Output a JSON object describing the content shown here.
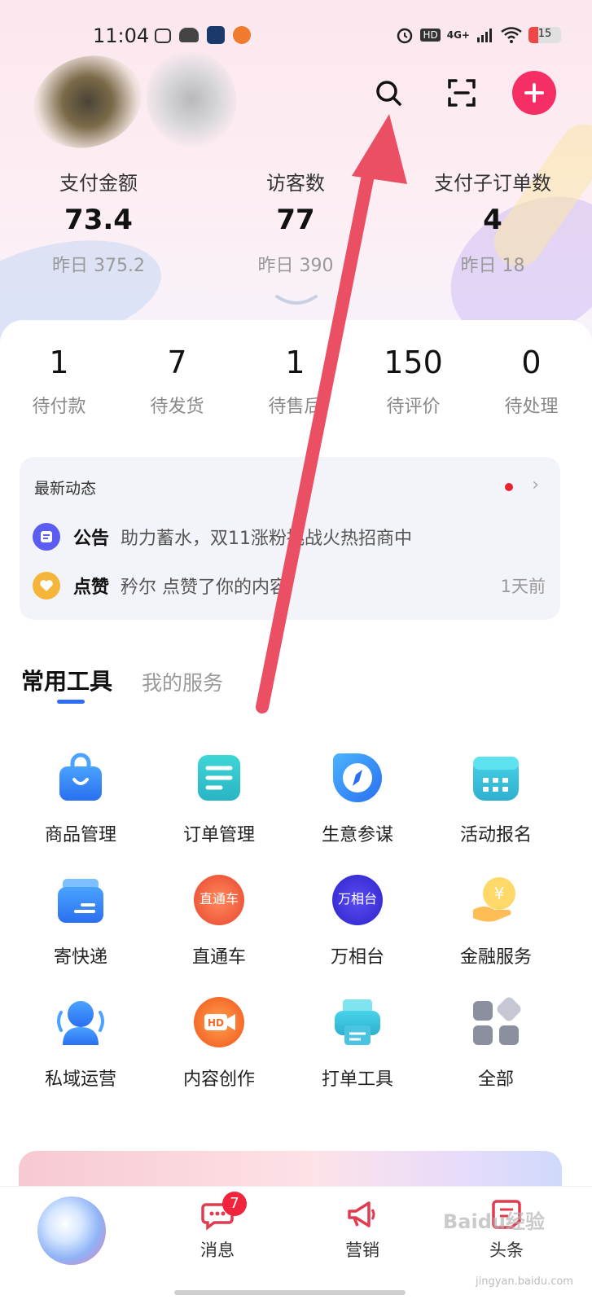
{
  "status_bar": {
    "time": "11:04",
    "network_label": "4G+",
    "hd_label": "HD",
    "battery": "15"
  },
  "header": {
    "search_icon": "search-icon",
    "scan_icon": "scan-icon",
    "add_icon": "plus-icon"
  },
  "stats": [
    {
      "label": "支付金额",
      "value": "73.4",
      "yesterday": "昨日 375.2"
    },
    {
      "label": "访客数",
      "value": "77",
      "yesterday": "昨日 390"
    },
    {
      "label": "支付子订单数",
      "value": "4",
      "yesterday": "昨日 18"
    }
  ],
  "orders": [
    {
      "count": "1",
      "label": "待付款"
    },
    {
      "count": "7",
      "label": "待发货"
    },
    {
      "count": "1",
      "label": "待售后"
    },
    {
      "count": "150",
      "label": "待评价"
    },
    {
      "count": "0",
      "label": "待处理"
    }
  ],
  "news": {
    "title": "最新动态",
    "items": [
      {
        "tag": "公告",
        "text": "助力蓄水，双11涨粉挑战火热招商中",
        "time": ""
      },
      {
        "tag": "点赞",
        "text": "矜尔 点赞了你的内容",
        "time": "1天前"
      }
    ]
  },
  "tabs": {
    "active": "常用工具",
    "inactive": "我的服务"
  },
  "tools": [
    {
      "label": "商品管理",
      "icon": "shopping-bag-icon"
    },
    {
      "label": "订单管理",
      "icon": "order-list-icon"
    },
    {
      "label": "生意参谋",
      "icon": "compass-icon"
    },
    {
      "label": "活动报名",
      "icon": "calendar-icon"
    },
    {
      "label": "寄快递",
      "icon": "box-icon",
      "inner": ""
    },
    {
      "label": "直通车",
      "icon": "zhitongche-icon",
      "inner": "直通车"
    },
    {
      "label": "万相台",
      "icon": "wanxiangtai-icon",
      "inner": "万相台"
    },
    {
      "label": "金融服务",
      "icon": "coin-hand-icon"
    },
    {
      "label": "私域运营",
      "icon": "user-icon"
    },
    {
      "label": "内容创作",
      "icon": "hd-camera-icon",
      "inner": "HD"
    },
    {
      "label": "打单工具",
      "icon": "printer-icon"
    },
    {
      "label": "全部",
      "icon": "grid-icon"
    }
  ],
  "bottom_nav": {
    "messages_label": "消息",
    "messages_badge": "7",
    "marketing_label": "营销",
    "headlines_label": "头条"
  },
  "colors": {
    "accent": "#f52f66",
    "tab_underline": "#2e6cf6",
    "annotation_arrow": "#ea4f63"
  }
}
